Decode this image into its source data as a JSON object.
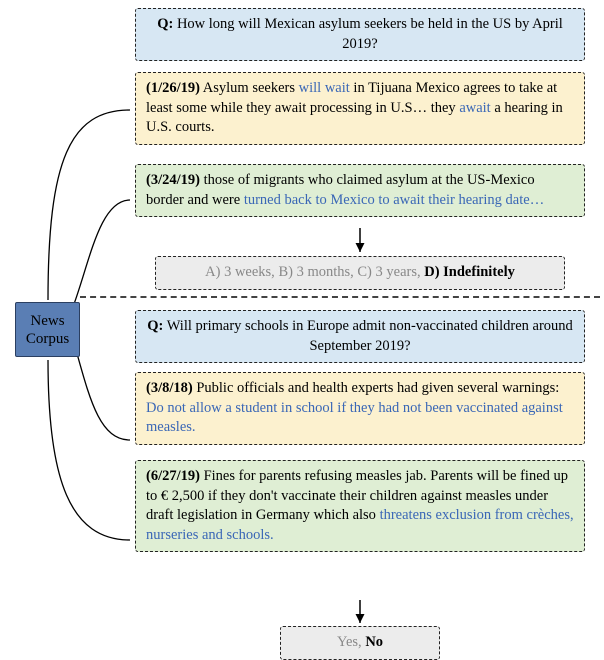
{
  "news_corpus_label": "News\nCorpus",
  "top": {
    "question_label": "Q:",
    "question_text": "How long will Mexican asylum seekers be held in the US by April 2019?",
    "snippet1": {
      "date": "(1/26/19)",
      "t1": " Asylum seekers ",
      "h1": "will wait",
      "t2": " in Tijuana Mexico agrees to take at least some while they await processing in U.S… they ",
      "h2": "await",
      "t3": " a hearing in U.S. courts."
    },
    "snippet2": {
      "date": "(3/24/19)",
      "t1": " those of migrants who claimed asylum at the US-Mexico border and were ",
      "h1": "turned back to Mexico to await their hearing date…"
    },
    "answers": {
      "wrong_a": "A) 3 weeks, ",
      "wrong_b": "B) 3 months, ",
      "wrong_c": "C) 3 years, ",
      "correct": "D) Indefinitely"
    }
  },
  "bottom": {
    "question_label": "Q:",
    "question_text": "Will primary schools in Europe admit non-vaccinated children around September 2019?",
    "snippet1": {
      "date": "(3/8/18)",
      "t1": " Public officials and health experts had given several warnings: ",
      "h1": "Do not allow a student in school if they had not been vaccinated against measles."
    },
    "snippet2": {
      "date": "(6/27/19)",
      "t1": " Fines for parents refusing measles jab. Parents will be fined up to € 2,500 if they don't vaccinate their children against measles under draft legislation in Germany which also ",
      "h1": "threatens exclusion from crèches, nurseries and schools."
    },
    "answers": {
      "wrong_yes": "Yes, ",
      "correct": "No"
    }
  }
}
